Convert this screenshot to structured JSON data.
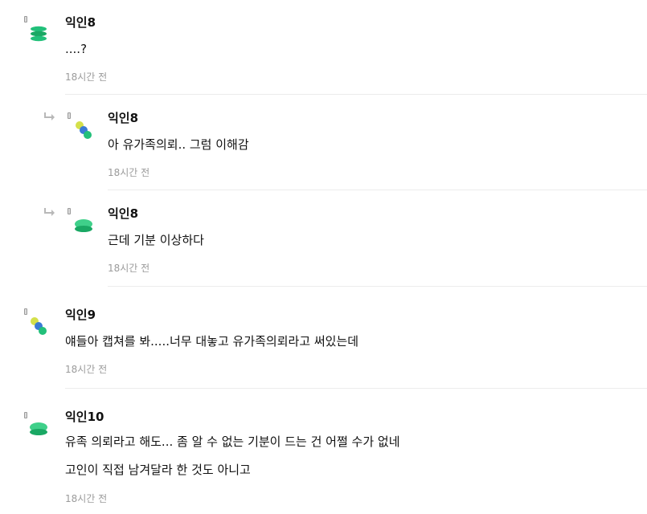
{
  "comments": [
    {
      "author": "익인8",
      "lines": [
        "....?"
      ],
      "time": "18시간 전",
      "avatar": "stacked-green-disks-icon"
    },
    {
      "author": "익인8",
      "lines": [
        "아 유가족의뢰.. 그럼 이해감"
      ],
      "time": "18시간 전",
      "avatar": "diagonal-circles-icon"
    },
    {
      "author": "익인8",
      "lines": [
        "근데 기분 이상하다"
      ],
      "time": "18시간 전",
      "avatar": "mushroom-green-icon"
    },
    {
      "author": "익인9",
      "lines": [
        "얘들아 캡쳐를 봐.....너무 대놓고 유가족의뢰라고 써있는데"
      ],
      "time": "18시간 전",
      "avatar": "diagonal-circles-icon"
    },
    {
      "author": "익인10",
      "lines": [
        "유족 의뢰라고 해도... 좀 알 수 없는 기분이 드는 건 어쩔 수가 없네",
        "고인이 직접 남겨달라 한 것도 아니고"
      ],
      "time": "18시간 전",
      "avatar": "mushroom-green-icon"
    }
  ],
  "colors": {
    "accent_green": "#22c07a",
    "accent_yellow": "#d4e04a",
    "accent_blue": "#3a7bd5"
  }
}
